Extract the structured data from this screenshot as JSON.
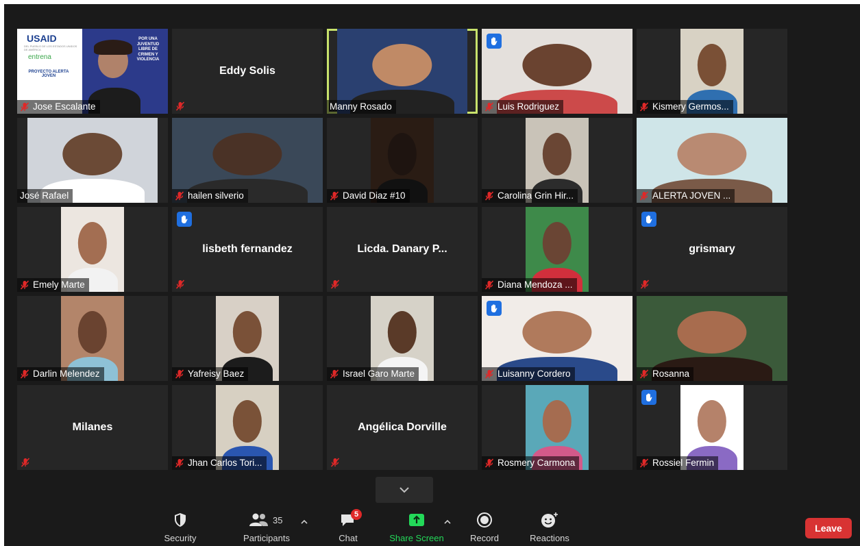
{
  "participants": [
    {
      "name": "Jose Escalante",
      "style": "banner",
      "muted": true,
      "hand": false,
      "active": false
    },
    {
      "name": "Eddy Solis",
      "style": "name",
      "muted": true,
      "hand": false,
      "active": false
    },
    {
      "name": "Manny Rosado",
      "style": "video",
      "muted": false,
      "hand": false,
      "active": true,
      "w": 190,
      "bg": "#2a4070",
      "skin": "#c08a66",
      "shirt": "#222222"
    },
    {
      "name": "Luis Rodriguez",
      "style": "video",
      "muted": true,
      "hand": true,
      "active": false,
      "w": 220,
      "bg": "#e4e0dc",
      "skin": "#6a4330",
      "shirt": "#cc4a4a"
    },
    {
      "name": "Kismery Germos...",
      "style": "video",
      "muted": true,
      "hand": false,
      "active": false,
      "w": 92,
      "bg": "#d8d2c4",
      "skin": "#7a5036",
      "shirt": "#2f6fb0"
    },
    {
      "name": "José Rafael",
      "style": "video",
      "muted": false,
      "hand": false,
      "active": false,
      "w": 190,
      "bg": "#d0d4da",
      "skin": "#6b4a36",
      "shirt": "#ffffff"
    },
    {
      "name": "hailen silverio",
      "style": "video",
      "muted": true,
      "hand": false,
      "active": false,
      "w": 220,
      "bg": "#3a4858",
      "skin": "#4a3226",
      "shirt": "#2a2a2a"
    },
    {
      "name": "David Diaz #10",
      "style": "video",
      "muted": true,
      "hand": false,
      "active": false,
      "w": 92,
      "bg": "#2a1c14",
      "skin": "#1e1410",
      "shirt": "#111111"
    },
    {
      "name": "Carolina Grin Hir...",
      "style": "video",
      "muted": true,
      "hand": false,
      "active": false,
      "w": 92,
      "bg": "#c9c3b8",
      "skin": "#6a4634",
      "shirt": "#2c2c2c"
    },
    {
      "name": "ALERTA JOVEN ...",
      "style": "video",
      "muted": true,
      "hand": false,
      "active": false,
      "w": 220,
      "bg": "#cfe5e8",
      "skin": "#b98a72",
      "shirt": "#7a5a48"
    },
    {
      "name": "Emely Marte",
      "style": "video",
      "muted": true,
      "hand": false,
      "active": false,
      "w": 92,
      "bg": "#ece6e0",
      "skin": "#a36e52",
      "shirt": "#f2f2f2"
    },
    {
      "name": "lisbeth fernandez",
      "style": "name",
      "muted": true,
      "hand": true,
      "active": false
    },
    {
      "name": "Licda. Danary P...",
      "style": "name",
      "muted": true,
      "hand": false,
      "active": false
    },
    {
      "name": "Diana Mendoza ...",
      "style": "video",
      "muted": true,
      "hand": false,
      "active": false,
      "w": 92,
      "bg": "#3e8a4a",
      "skin": "#6a4534",
      "shirt": "#d12f3c"
    },
    {
      "name": "grismary",
      "style": "name",
      "muted": true,
      "hand": true,
      "active": false
    },
    {
      "name": "Darlin Melendez",
      "style": "video",
      "muted": true,
      "hand": false,
      "active": false,
      "w": 92,
      "bg": "#b3856a",
      "skin": "#6a4330",
      "shirt": "#8ec1d6"
    },
    {
      "name": "Yafreisy Baez",
      "style": "video",
      "muted": true,
      "hand": false,
      "active": false,
      "w": 92,
      "bg": "#d8d0c6",
      "skin": "#7a5138",
      "shirt": "#1c1c1c"
    },
    {
      "name": "Israel Garo Marte",
      "style": "video",
      "muted": true,
      "hand": false,
      "active": false,
      "w": 92,
      "bg": "#d6d2c8",
      "skin": "#5a3a28",
      "shirt": "#f4f4f4"
    },
    {
      "name": "Luisanny Cordero",
      "style": "video",
      "muted": true,
      "hand": true,
      "active": false,
      "w": 220,
      "bg": "#f1ece8",
      "skin": "#b07a5c",
      "shirt": "#2a4a8a"
    },
    {
      "name": "Rosanna",
      "style": "video",
      "muted": true,
      "hand": false,
      "active": false,
      "w": 220,
      "bg": "#3b5a3a",
      "skin": "#a86c4e",
      "shirt": "#2a1a14"
    },
    {
      "name": "Milanes",
      "style": "name",
      "muted": true,
      "hand": false,
      "active": false
    },
    {
      "name": "Jhan Carlos Tori...",
      "style": "video",
      "muted": true,
      "hand": false,
      "active": false,
      "w": 92,
      "bg": "#d7d0c2",
      "skin": "#7a5238",
      "shirt": "#2a56b0"
    },
    {
      "name": "Angélica Dorville",
      "style": "name",
      "muted": true,
      "hand": false,
      "active": false
    },
    {
      "name": "Rosmery Carmona",
      "style": "video",
      "muted": true,
      "hand": false,
      "active": false,
      "w": 92,
      "bg": "#5aa8b8",
      "skin": "#a56c50",
      "shirt": "#d35a8a"
    },
    {
      "name": "Rossiel Fermin",
      "style": "video",
      "muted": true,
      "hand": true,
      "active": false,
      "w": 92,
      "bg": "#ffffff",
      "skin": "#b5826a",
      "shirt": "#8a6ac4"
    }
  ],
  "banner": {
    "logo": "USAID",
    "logo_sub": "DEL PUEBLO DE LOS ESTADOS UNIDOS DE AMÉRICA",
    "brand": "entrena",
    "project": "PROYECTO ALERTA JOVEN",
    "slogan": "POR UNA JUVENTUD LIBRE DE CRIMEN Y VIOLENCIA"
  },
  "toolbar": {
    "security": "Security",
    "participants": "Participants",
    "participants_count": "35",
    "chat": "Chat",
    "chat_badge": "5",
    "share": "Share Screen",
    "record": "Record",
    "reactions": "Reactions",
    "leave": "Leave"
  },
  "colors": {
    "background": "#1a1a1a",
    "tile": "#262626",
    "active_border": "#c8e26c",
    "mute_red": "#e02828",
    "hand_blue": "#1f6fe0",
    "share_green": "#23d959",
    "leave_red": "#d83333"
  }
}
